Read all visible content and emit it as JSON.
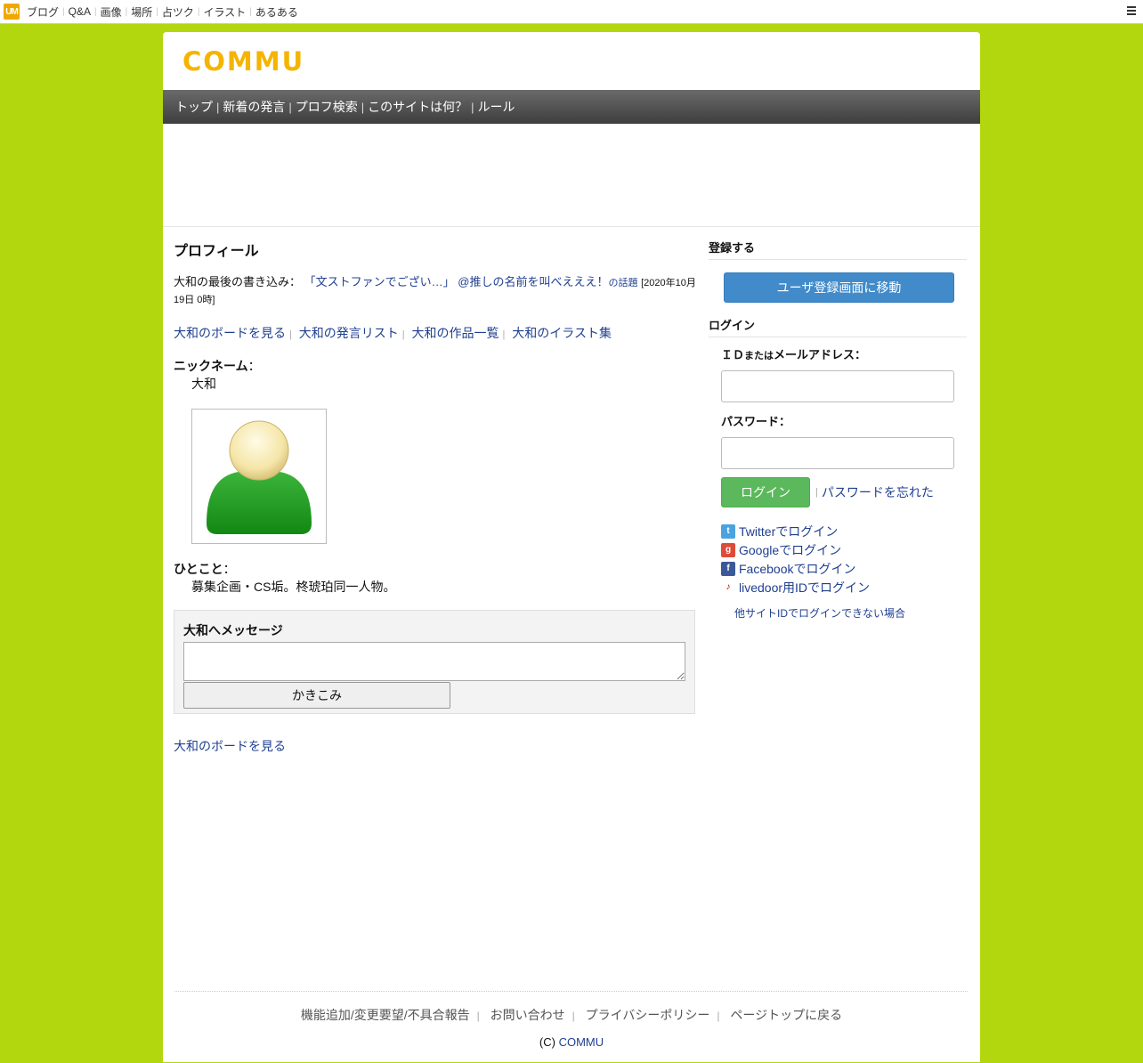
{
  "topbar": {
    "logo": "UM",
    "links": [
      "ブログ",
      "Q&A",
      "画像",
      "場所",
      "占ツク",
      "イラスト",
      "あるある"
    ]
  },
  "site": {
    "logo_text": "COMMU"
  },
  "nav": {
    "items": [
      "トップ",
      "新着の発言",
      "プロフ検索",
      "このサイトは何？",
      "ルール"
    ]
  },
  "profile": {
    "title": "プロフィール",
    "last_post_label": "大和の最後の書き込み：",
    "last_post_link": "「文ストファンでござい…」",
    "topic_link": "@推しの名前を叫べえええ！",
    "topic_suffix": "の話題",
    "last_post_date": "[2020年10月19日 0時]",
    "links": [
      "大和のボードを見る",
      "大和の発言リスト",
      "大和の作品一覧",
      "大和のイラスト集"
    ],
    "nickname_label": "ニックネーム",
    "nickname_sep": "：",
    "nickname": "大和",
    "hitokoto_label": "ひとこと",
    "hitokoto_sep": "：",
    "hitokoto": "募集企画・CS垢。柊琥珀同一人物。",
    "message_title": "大和へメッセージ",
    "message_value": "",
    "submit_label": "かきこみ",
    "board_link": "大和のボードを見る"
  },
  "sidebar": {
    "register_title": "登録する",
    "register_button": "ユーザ登録画面に移動",
    "login_title": "ログイン",
    "id_label_pre": "ＩＤ",
    "id_label_small": "または",
    "id_label_post": "メールアドレス：",
    "password_label": "パスワード：",
    "login_button": "ログイン",
    "forgot_link": "パスワードを忘れた",
    "social": [
      {
        "label": "Twitterでログイン",
        "icon": "twitter-icon",
        "color": "#4aa3df"
      },
      {
        "label": "Googleでログイン",
        "icon": "google-icon",
        "color": "#dd4b39"
      },
      {
        "label": "Facebookでログイン",
        "icon": "facebook-icon",
        "color": "#3b5998"
      },
      {
        "label": "livedoor用IDでログイン",
        "icon": "livedoor-icon",
        "color": "#cc0000"
      }
    ],
    "other_site_link": "他サイトIDでログインできない場合"
  },
  "footer": {
    "links": [
      "機能追加/変更要望/不具合報告",
      "お問い合わせ",
      "プライバシーポリシー",
      "ページトップに戻る"
    ],
    "copyright_prefix": "(C)",
    "copyright_link": "COMMU"
  },
  "colors": {
    "background": "#b2d70e",
    "logo": "#f5b400",
    "register_button": "#428bca",
    "login_button": "#5cb85c",
    "link": "#1f3f8f"
  }
}
